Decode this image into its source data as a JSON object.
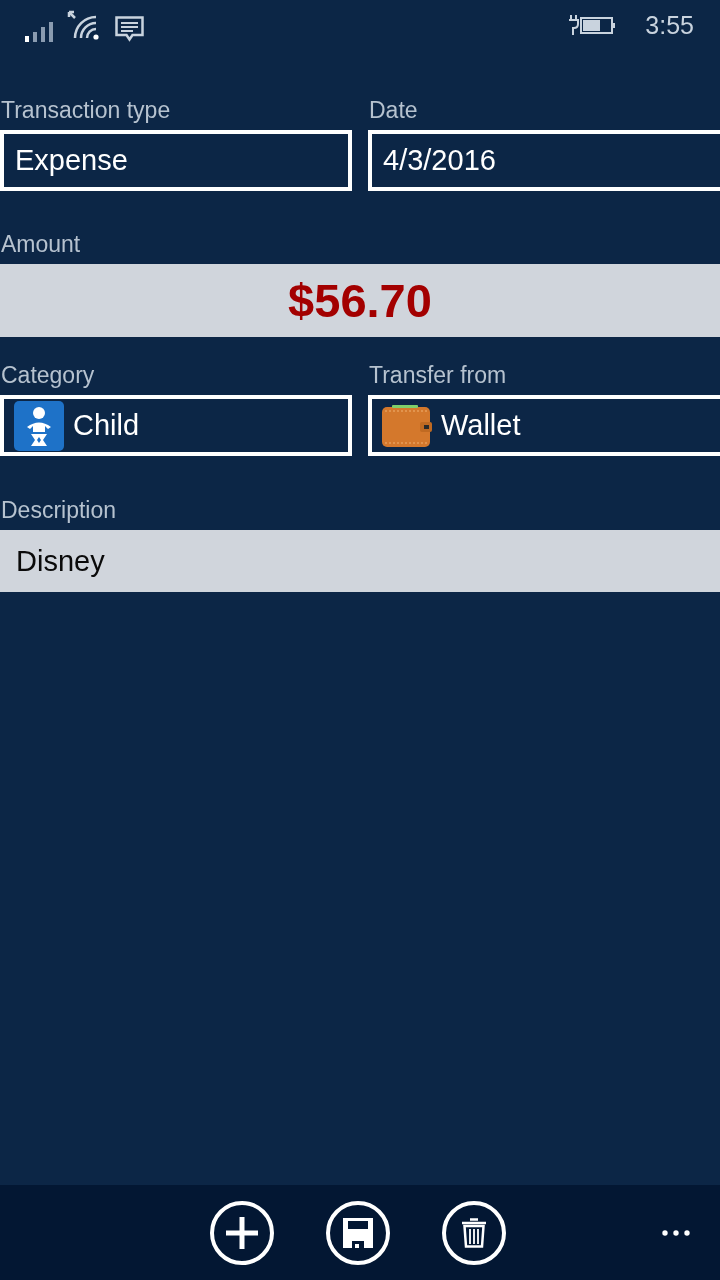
{
  "status_bar": {
    "time": "3:55"
  },
  "form": {
    "transaction_type": {
      "label": "Transaction type",
      "value": "Expense"
    },
    "date": {
      "label": "Date",
      "value": "4/3/2016"
    },
    "amount": {
      "label": "Amount",
      "value": "$56.70"
    },
    "category": {
      "label": "Category",
      "value": "Child"
    },
    "transfer_from": {
      "label": "Transfer from",
      "value": "Wallet"
    },
    "description": {
      "label": "Description",
      "value": "Disney"
    }
  },
  "app_bar": {
    "buttons": [
      {
        "kind": "add"
      },
      {
        "kind": "save"
      },
      {
        "kind": "delete"
      },
      {
        "kind": "more"
      }
    ]
  }
}
